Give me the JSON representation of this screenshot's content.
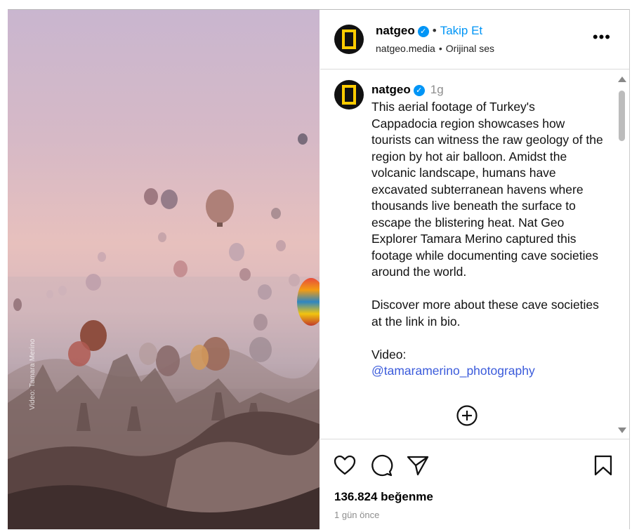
{
  "media": {
    "credit": "Video: Tamara Merino"
  },
  "header": {
    "username": "natgeo",
    "verified_glyph": "✓",
    "separator": "•",
    "follow_label": "Takip Et",
    "account": "natgeo.media",
    "audio": "Orijinal ses",
    "more_label": "•••"
  },
  "caption": {
    "username": "natgeo",
    "time": "1g",
    "paragraphs": [
      "This aerial footage of Turkey's Cappadocia region showcases how tourists can witness the raw geology of the region by hot air balloon. Amidst the volcanic landscape, humans have excavated subterranean havens where thousands live beneath the surface to escape the blistering heat. Nat Geo Explorer Tamara Merino captured this footage while documenting cave societies around the world.",
      "Discover more about these cave societies at the link in bio."
    ],
    "video_by_label": "Video:",
    "video_by_link": "@tamaramerino_photography"
  },
  "icons": {
    "logo": "natgeo-logo-icon",
    "verified": "verified-badge-icon",
    "more": "more-options-icon",
    "add": "plus-circle-icon",
    "like": "heart-icon",
    "comment": "comment-icon",
    "share": "send-icon",
    "save": "bookmark-icon"
  },
  "stats": {
    "likes": "136.824 beğenme",
    "time_ago": "1 gün önce"
  },
  "colors": {
    "accent": "#0095f6",
    "link": "#3b5bdb",
    "logo_yellow": "#ffcc00"
  }
}
